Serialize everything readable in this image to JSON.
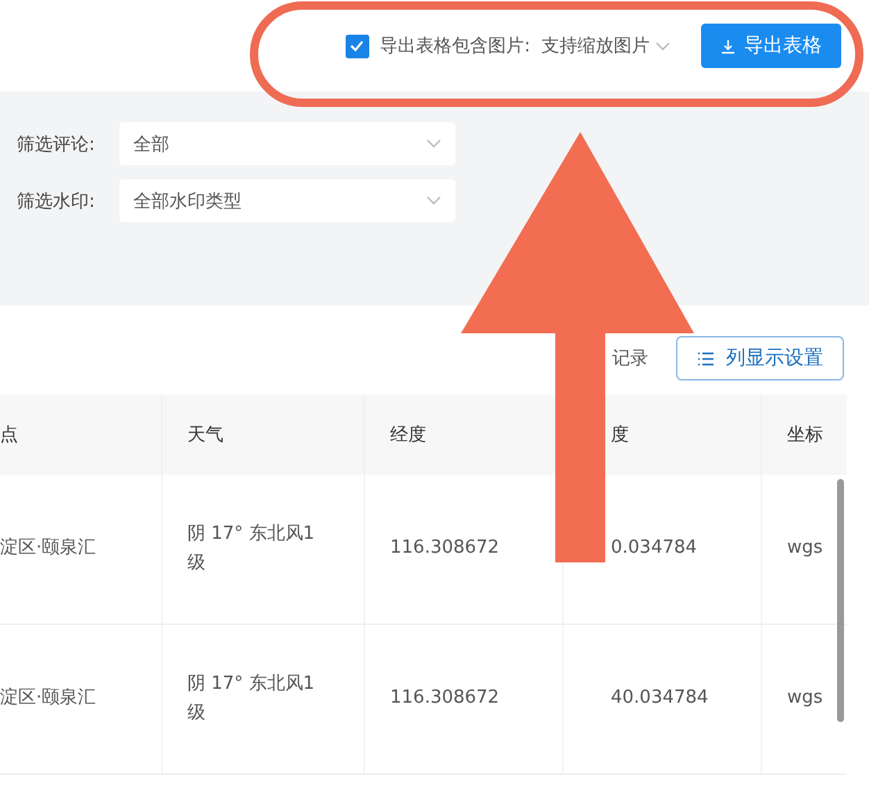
{
  "export_bar": {
    "include_images": {
      "label": "导出表格包含图片:",
      "checked": true
    },
    "image_mode": "支持缩放图片",
    "export_button": "导出表格"
  },
  "filters": [
    {
      "label": "筛选评论:",
      "value": "全部"
    },
    {
      "label": "筛选水印:",
      "value": "全部水印类型"
    }
  ],
  "toolbar": {
    "record_text": "记录",
    "column_settings_button": "列显示设置"
  },
  "table": {
    "columns": [
      "点",
      "天气",
      "经度",
      "度",
      "坐标"
    ],
    "rows": [
      [
        "淀区·颐泉汇",
        "阴 17° 东北风1级",
        "116.308672",
        "0.034784",
        "wgs"
      ],
      [
        "淀区·颐泉汇",
        "阴 17° 东北风1级",
        "116.308672",
        "40.034784",
        "wgs"
      ]
    ]
  }
}
